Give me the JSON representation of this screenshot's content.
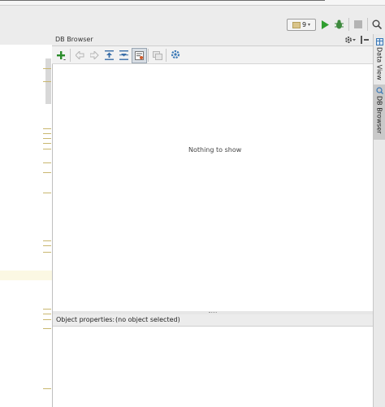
{
  "run_toolbar": {
    "run_config_label": "9",
    "colors": {
      "run": "#2f9e2f",
      "debug": "#3e8a3e",
      "stop": "#b3b3b3"
    }
  },
  "panel": {
    "title": "DB Browser",
    "toolbar": {
      "icons": [
        "add-connection-icon",
        "back-icon",
        "forward-icon",
        "collapse-all-icon",
        "expand-all-icon",
        "filter-icon",
        "duplicate-icon",
        "settings-icon"
      ],
      "accent": "#2a8c2a"
    },
    "tree_empty_message": "Nothing to show",
    "properties": {
      "label": "Object properties:",
      "value": "(no object selected)"
    }
  },
  "sidebar": {
    "tabs": [
      {
        "label": "Data View",
        "icon": "table-icon"
      },
      {
        "label": "DB Browser",
        "icon": "db-search-icon",
        "active": true
      }
    ]
  }
}
